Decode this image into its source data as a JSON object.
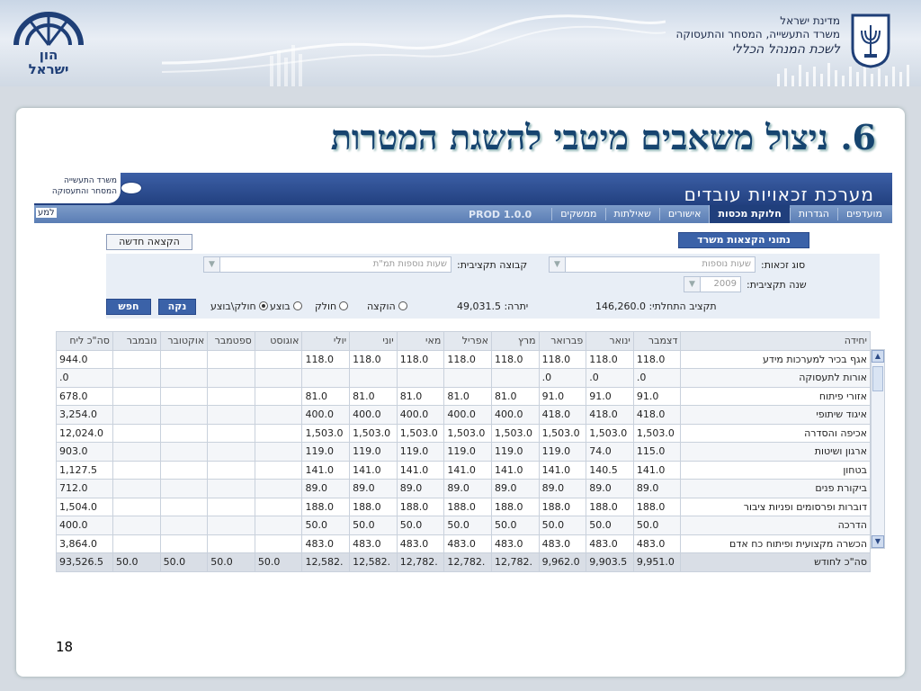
{
  "header": {
    "logo_text": "הון\nישראל",
    "ministry_lines": [
      "מדינת ישראל",
      "משרד התעשייה, המסחר והתעסוקה"
    ],
    "office": "לשכת המנהל הכללי"
  },
  "slide": {
    "title": "6. ניצול משאבים מיטבי להשגת המטרות",
    "page_number": "18"
  },
  "app": {
    "title": "מערכת זכאויות עובדים",
    "ministry_small": [
      "משרד התעשייה",
      "המסחר והתעסוקה"
    ],
    "nav_left": "למע",
    "tabs": [
      "מועדפים",
      "הגדרות",
      "חלוקת מכסות",
      "אישורים",
      "שאילתות",
      "ממשקים"
    ],
    "active_tab": "חלוקת מכסות",
    "version": "PROD 1.0.0"
  },
  "panel": {
    "new_allocation": "הקצאה חדשה",
    "office_data": "נתוני הקצאות משרד",
    "eligibility_type_label": "סוג זכאות:",
    "eligibility_type_value": "שעות נוספות",
    "budget_group_label": "קבוצה תקציבית:",
    "budget_group_value": "שעות נוספות תמ\"ת",
    "budget_year_label": "שנה תקציבית:",
    "budget_year_value": "2009",
    "initial_budget": "תקציב התחלתי: 146,260.0",
    "balance": "יתרה: 49,031.5",
    "radio_options": [
      "הוקצה",
      "חולק",
      "בוצע",
      "חולק\\בוצע"
    ],
    "radio_selected": "חולק\\בוצע",
    "clear": "נקה",
    "search": "חפש"
  },
  "grid": {
    "columns": [
      "יחידה",
      "דצמבר",
      "ינואר",
      "פברואר",
      "מרץ",
      "אפריל",
      "מאי",
      "יוני",
      "יולי",
      "אוגוסט",
      "ספטמבר",
      "אוקטובר",
      "נובמבר",
      "סה\"כ ליח"
    ],
    "rows": [
      [
        "אגף בכיר למערכות מידע",
        "118.0",
        "118.0",
        "118.0",
        "118.0",
        "118.0",
        "118.0",
        "118.0",
        "118.0",
        "",
        "",
        "",
        "",
        "944.0"
      ],
      [
        "אורות לתעסוקה",
        ".0",
        ".0",
        ".0",
        "",
        "",
        "",
        "",
        "",
        "",
        "",
        "",
        "",
        ".0"
      ],
      [
        "אזורי פיתוח",
        "91.0",
        "91.0",
        "91.0",
        "81.0",
        "81.0",
        "81.0",
        "81.0",
        "81.0",
        "",
        "",
        "",
        "",
        "678.0"
      ],
      [
        "איגוד שיתופי",
        "418.0",
        "418.0",
        "418.0",
        "400.0",
        "400.0",
        "400.0",
        "400.0",
        "400.0",
        "",
        "",
        "",
        "",
        "3,254.0"
      ],
      [
        "אכיפה והסדרה",
        "1,503.0",
        "1,503.0",
        "1,503.0",
        "1,503.0",
        "1,503.0",
        "1,503.0",
        "1,503.0",
        "1,503.0",
        "",
        "",
        "",
        "",
        "12,024.0"
      ],
      [
        "ארגון ושיטות",
        "115.0",
        "74.0",
        "119.0",
        "119.0",
        "119.0",
        "119.0",
        "119.0",
        "119.0",
        "",
        "",
        "",
        "",
        "903.0"
      ],
      [
        "בטחון",
        "141.0",
        "140.5",
        "141.0",
        "141.0",
        "141.0",
        "141.0",
        "141.0",
        "141.0",
        "",
        "",
        "",
        "",
        "1,127.5"
      ],
      [
        "ביקורת פנים",
        "89.0",
        "89.0",
        "89.0",
        "89.0",
        "89.0",
        "89.0",
        "89.0",
        "89.0",
        "",
        "",
        "",
        "",
        "712.0"
      ],
      [
        "דוברות ופרסומים ופניות ציבור",
        "188.0",
        "188.0",
        "188.0",
        "188.0",
        "188.0",
        "188.0",
        "188.0",
        "188.0",
        "",
        "",
        "",
        "",
        "1,504.0"
      ],
      [
        "הדרכה",
        "50.0",
        "50.0",
        "50.0",
        "50.0",
        "50.0",
        "50.0",
        "50.0",
        "50.0",
        "",
        "",
        "",
        "",
        "400.0"
      ],
      [
        "הכשרה מקצועית ופיתוח כח אדם",
        "483.0",
        "483.0",
        "483.0",
        "483.0",
        "483.0",
        "483.0",
        "483.0",
        "483.0",
        "",
        "",
        "",
        "",
        "3,864.0"
      ]
    ],
    "total_row": [
      "סה\"כ לחודש",
      "9,951.0",
      "9,903.5",
      "9,962.0",
      "12,782.",
      "12,782.",
      "12,782.",
      "12,582.",
      "12,582.",
      "50.0",
      "50.0",
      "50.0",
      "50.0",
      "93,526.5"
    ]
  }
}
